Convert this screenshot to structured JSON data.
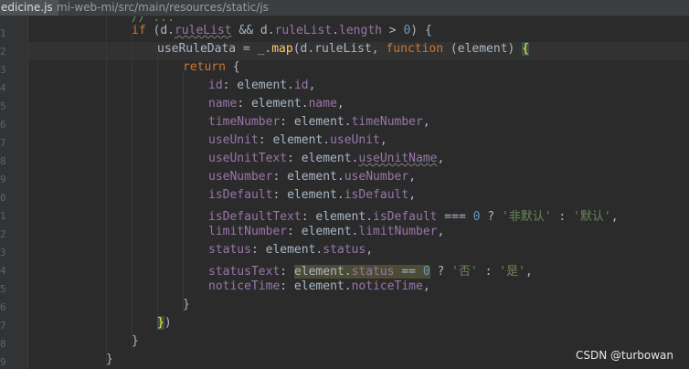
{
  "tab": {
    "filename": "edicine.js"
  },
  "breadcrumb": "mi-web-mi/src/main/resources/static/js",
  "gutter": {
    "line_numbers": [
      "1",
      "2",
      "3",
      "4",
      "5",
      "6",
      "7",
      "8",
      "9",
      "0",
      "1",
      "2",
      "3",
      "4",
      "5",
      "6",
      "7",
      "8",
      "9"
    ]
  },
  "code": {
    "partial_top": "// ...",
    "if_kw": "if",
    "cond_a": "d.",
    "cond_a_prop": "ruleList",
    "cond_and": " && d.",
    "cond_b_prop": "ruleList",
    "cond_dot": ".",
    "cond_length": "length",
    "cond_gt": " > ",
    "cond_zero": "0",
    "cond_tail": ") {",
    "assign_var": "useRuleData = _.",
    "map_fn": "map",
    "map_args": "(d.ruleList, ",
    "function_kw": "function",
    "map_param": " (element) ",
    "map_open_brace": "{",
    "return_kw": "return",
    "return_brace": " {",
    "fields": [
      {
        "key": "id",
        "sep": ": element.",
        "val": "id",
        "tail": ","
      },
      {
        "key": "name",
        "sep": ": element.",
        "val": "name",
        "tail": ","
      },
      {
        "key": "timeNumber",
        "sep": ": element.",
        "val": "timeNumber",
        "tail": ","
      },
      {
        "key": "useUnit",
        "sep": ": element.",
        "val": "useUnit",
        "tail": ","
      },
      {
        "key": "useUnitText",
        "sep": ": element.",
        "val": "useUnitName",
        "tail": ","
      },
      {
        "key": "useNumber",
        "sep": ": element.",
        "val": "useNumber",
        "tail": ","
      },
      {
        "key": "isDefault",
        "sep": ": element.",
        "val": "isDefault",
        "tail": ","
      }
    ],
    "isDefaultText": {
      "key": "isDefaultText",
      "sep": ": element.",
      "val": "isDefault",
      "op": " === ",
      "zero": "0",
      "q": " ? ",
      "str_true": "'非默认'",
      "colon": " : ",
      "str_false": "'默认'",
      "tail": ","
    },
    "limitNumber": {
      "key": "limitNumber",
      "sep": ": element.",
      "val": "limitNumber",
      "tail": ","
    },
    "status": {
      "key": "status",
      "sep": ": element.",
      "val": "status",
      "tail": ","
    },
    "statusText": {
      "key": "statusText",
      "sep": ": ",
      "obj": "element.",
      "val": "status",
      "op": " == ",
      "zero": "0",
      "q": " ? ",
      "str_true": "'否'",
      "colon": " : ",
      "str_false": "'是'",
      "tail": ","
    },
    "noticeTime": {
      "key": "noticeTime",
      "sep": ": element.",
      "val": "noticeTime",
      "tail": ","
    },
    "close_return": "}",
    "close_map_brace": "}",
    "close_map_paren": ")",
    "close_if": "}",
    "close_outer": "}"
  },
  "watermark": "CSDN @turbowan",
  "colors": {
    "background": "#2b2b2b",
    "keyword": "#cc7832",
    "property": "#9876aa",
    "function": "#ffc66d",
    "number": "#6897bb",
    "string": "#6a8759"
  }
}
